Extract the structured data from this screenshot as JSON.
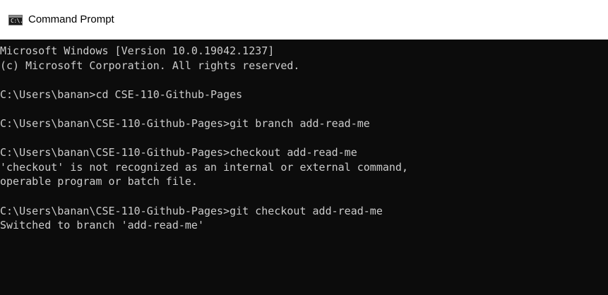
{
  "window": {
    "title": "Command Prompt",
    "icon": "cmd-icon",
    "icon_glyph": "C:\\."
  },
  "colors": {
    "background": "#0c0c0c",
    "text": "#cccccc",
    "titlebar": "#ffffff"
  },
  "console": {
    "lines": [
      "Microsoft Windows [Version 10.0.19042.1237]",
      "(c) Microsoft Corporation. All rights reserved.",
      "",
      "C:\\Users\\banan>cd CSE-110-Github-Pages",
      "",
      "C:\\Users\\banan\\CSE-110-Github-Pages>git branch add-read-me",
      "",
      "C:\\Users\\banan\\CSE-110-Github-Pages>checkout add-read-me",
      "'checkout' is not recognized as an internal or external command,",
      "operable program or batch file.",
      "",
      "C:\\Users\\banan\\CSE-110-Github-Pages>git checkout add-read-me",
      "Switched to branch 'add-read-me'"
    ]
  }
}
